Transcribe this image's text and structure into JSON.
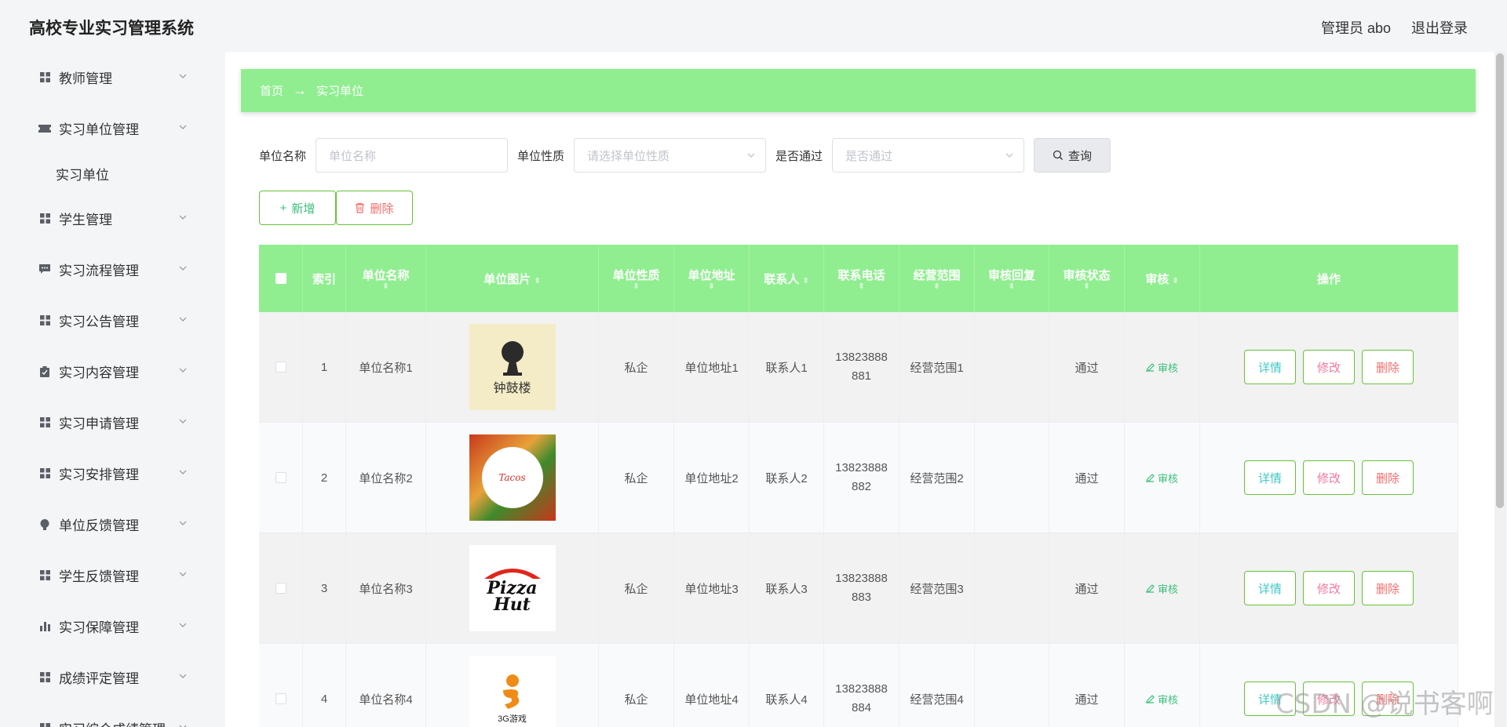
{
  "app": {
    "title": "高校专业实习管理系统",
    "user_label": "管理员 abo",
    "logout_label": "退出登录"
  },
  "sidebar": {
    "items": [
      {
        "label": "教师管理",
        "icon": "grid-icon"
      },
      {
        "label": "实习单位管理",
        "icon": "ticket-icon",
        "expanded": true,
        "children": [
          "实习单位"
        ]
      },
      {
        "label": "学生管理",
        "icon": "grid-icon"
      },
      {
        "label": "实习流程管理",
        "icon": "chat-icon"
      },
      {
        "label": "实习公告管理",
        "icon": "grid-icon"
      },
      {
        "label": "实习内容管理",
        "icon": "clipboard-icon"
      },
      {
        "label": "实习申请管理",
        "icon": "grid-icon"
      },
      {
        "label": "实习安排管理",
        "icon": "grid-icon"
      },
      {
        "label": "单位反馈管理",
        "icon": "bulb-icon"
      },
      {
        "label": "学生反馈管理",
        "icon": "grid-icon"
      },
      {
        "label": "实习保障管理",
        "icon": "bar-chart-icon"
      },
      {
        "label": "成绩评定管理",
        "icon": "grid-icon"
      },
      {
        "label": "实习综合成绩管理",
        "icon": "grid-icon"
      }
    ]
  },
  "breadcrumb": {
    "home": "首页",
    "arrow": "→",
    "current": "实习单位"
  },
  "search": {
    "name_label": "单位名称",
    "name_placeholder": "单位名称",
    "type_label": "单位性质",
    "type_placeholder": "请选择单位性质",
    "pass_label": "是否通过",
    "pass_placeholder": "是否通过",
    "query_label": "查询"
  },
  "actions": {
    "add_label": "新增",
    "delete_label": "删除"
  },
  "table": {
    "headers": {
      "index": "索引",
      "name": "单位名称",
      "image": "单位图片",
      "type": "单位性质",
      "address": "单位地址",
      "contact": "联系人",
      "phone": "联系电话",
      "scope": "经营范围",
      "reply": "审核回复",
      "status": "审核状态",
      "audit": "审核",
      "ops": "操作"
    },
    "rows": [
      {
        "index": "1",
        "name": "单位名称1",
        "type": "私企",
        "address": "单位地址1",
        "contact": "联系人1",
        "phone1": "13823888",
        "phone2": "881",
        "scope": "经营范围1",
        "reply": "",
        "status": "通过",
        "image": "drum-tower-logo"
      },
      {
        "index": "2",
        "name": "单位名称2",
        "type": "私企",
        "address": "单位地址2",
        "contact": "联系人2",
        "phone1": "13823888",
        "phone2": "882",
        "scope": "经营范围2",
        "reply": "",
        "status": "通过",
        "image": "tacos-logo"
      },
      {
        "index": "3",
        "name": "单位名称3",
        "type": "私企",
        "address": "单位地址3",
        "contact": "联系人3",
        "phone1": "13823888",
        "phone2": "883",
        "scope": "经营范围3",
        "reply": "",
        "status": "通过",
        "image": "pizza-hut-logo"
      },
      {
        "index": "4",
        "name": "单位名称4",
        "type": "私企",
        "address": "单位地址4",
        "contact": "联系人4",
        "phone1": "13823888",
        "phone2": "884",
        "scope": "经营范围4",
        "reply": "",
        "status": "通过",
        "image": "game-logo"
      }
    ],
    "audit_label": "审核",
    "detail_label": "详情",
    "edit_label": "修改",
    "delete_label": "删除"
  },
  "watermark": "CSDN @说书客啊",
  "colors": {
    "accent": "#90ee90",
    "green_text": "#3bbf7a",
    "danger": "#f56c6c",
    "info": "#40c9c6",
    "edit": "#f078a0"
  }
}
